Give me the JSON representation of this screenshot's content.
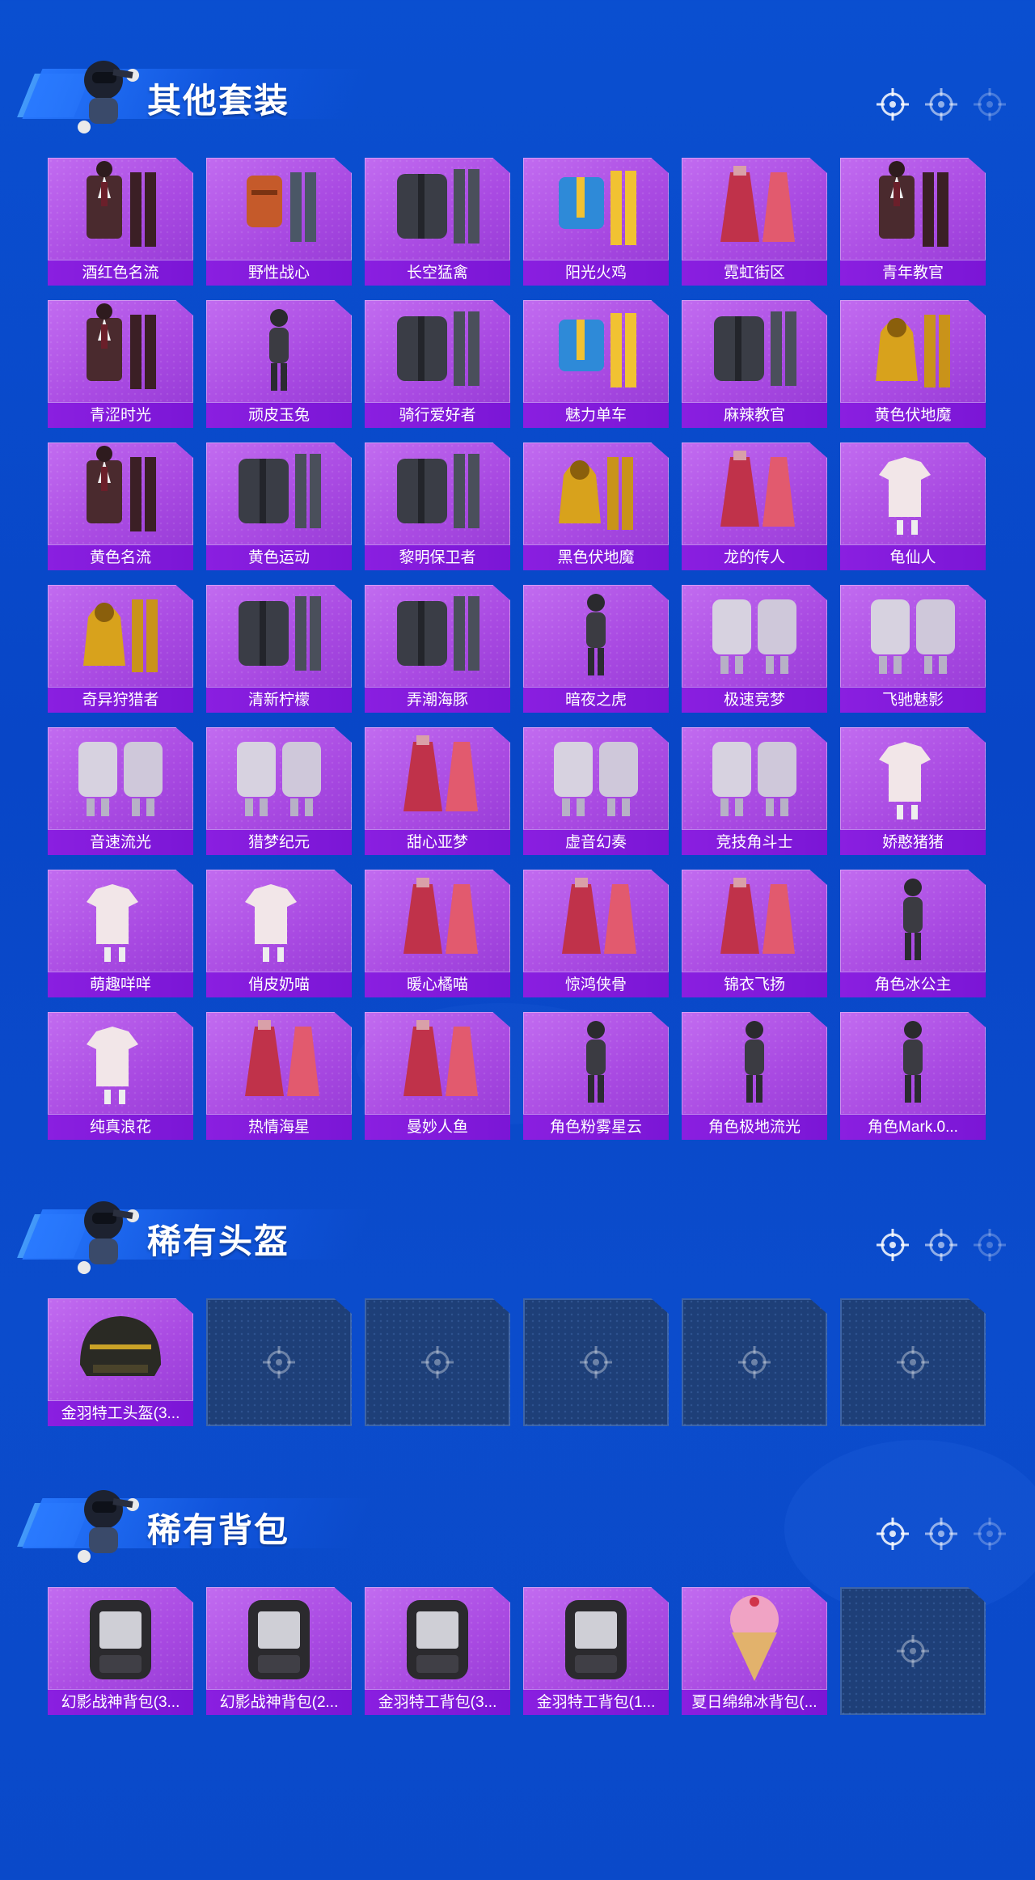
{
  "sections": [
    {
      "title": "其他套装",
      "items": [
        {
          "name": "酒红色名流",
          "art": "suit"
        },
        {
          "name": "野性战心",
          "art": "vest"
        },
        {
          "name": "长空猛禽",
          "art": "jacket"
        },
        {
          "name": "阳光火鸡",
          "art": "casual"
        },
        {
          "name": "霓虹街区",
          "art": "dress"
        },
        {
          "name": "青年教官",
          "art": "suit"
        },
        {
          "name": "青涩时光",
          "art": "suit"
        },
        {
          "name": "顽皮玉兔",
          "art": "figure"
        },
        {
          "name": "骑行爱好者",
          "art": "jacket"
        },
        {
          "name": "魅力单车",
          "art": "casual"
        },
        {
          "name": "麻辣教官",
          "art": "jacket"
        },
        {
          "name": "黄色伏地魔",
          "art": "hoodie"
        },
        {
          "name": "黄色名流",
          "art": "suit"
        },
        {
          "name": "黄色运动",
          "art": "jacket"
        },
        {
          "name": "黎明保卫者",
          "art": "jacket"
        },
        {
          "name": "黑色伏地魔",
          "art": "hoodie"
        },
        {
          "name": "龙的传人",
          "art": "dress"
        },
        {
          "name": "龟仙人",
          "art": "shirt"
        },
        {
          "name": "奇异狩猎者",
          "art": "hoodie"
        },
        {
          "name": "清新柠檬",
          "art": "jacket"
        },
        {
          "name": "弄潮海豚",
          "art": "jacket"
        },
        {
          "name": "暗夜之虎",
          "art": "figure"
        },
        {
          "name": "极速竞梦",
          "art": "armor"
        },
        {
          "name": "飞驰魅影",
          "art": "armor"
        },
        {
          "name": "音速流光",
          "art": "armor"
        },
        {
          "name": "猎梦纪元",
          "art": "armor"
        },
        {
          "name": "甜心亚梦",
          "art": "dress"
        },
        {
          "name": "虚音幻奏",
          "art": "armor"
        },
        {
          "name": "竞技角斗士",
          "art": "armor"
        },
        {
          "name": "娇憨猪猪",
          "art": "shirt"
        },
        {
          "name": "萌趣咩咩",
          "art": "shirt"
        },
        {
          "name": "俏皮奶喵",
          "art": "shirt"
        },
        {
          "name": "暖心橘喵",
          "art": "dress"
        },
        {
          "name": "惊鸿侠骨",
          "art": "dress"
        },
        {
          "name": "锦衣飞扬",
          "art": "dress"
        },
        {
          "name": "角色冰公主",
          "art": "figure"
        },
        {
          "name": "纯真浪花",
          "art": "shirt"
        },
        {
          "name": "热情海星",
          "art": "dress"
        },
        {
          "name": "曼妙人鱼",
          "art": "dress"
        },
        {
          "name": "角色粉雾星云",
          "art": "figure"
        },
        {
          "name": "角色极地流光",
          "art": "figure"
        },
        {
          "name": "角色Mark.0...",
          "art": "figure"
        }
      ]
    },
    {
      "title": "稀有头盔",
      "items": [
        {
          "name": "金羽特工头盔(3...",
          "art": "helmet"
        },
        {
          "empty": true
        },
        {
          "empty": true
        },
        {
          "empty": true
        },
        {
          "empty": true
        },
        {
          "empty": true
        }
      ]
    },
    {
      "title": "稀有背包",
      "items": [
        {
          "name": "幻影战神背包(3...",
          "art": "backpack"
        },
        {
          "name": "幻影战神背包(2...",
          "art": "backpack"
        },
        {
          "name": "金羽特工背包(3...",
          "art": "backpack"
        },
        {
          "name": "金羽特工背包(1...",
          "art": "backpack"
        },
        {
          "name": "夏日绵绵冰背包(...",
          "art": "icecream"
        },
        {
          "empty": true
        }
      ]
    }
  ],
  "colors": {
    "background": "#0a4fd0",
    "card": "#a94ae2",
    "label_bar": "#8a1fe0",
    "empty_slot": "#1e3f78"
  }
}
